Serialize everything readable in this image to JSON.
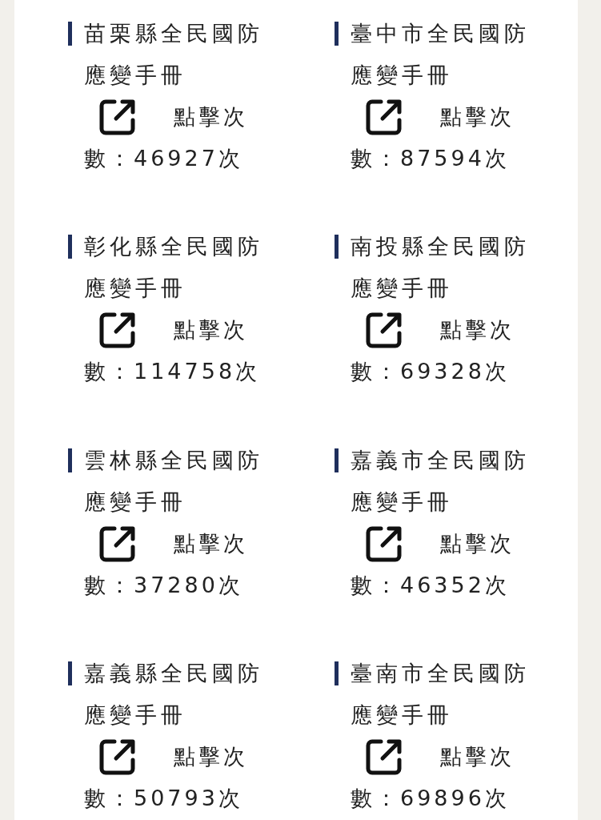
{
  "cards": [
    {
      "title": "苗栗縣全民國防應變手冊",
      "clicks_line_1": "點擊次",
      "clicks_line_2": "數：46927次"
    },
    {
      "title": "臺中市全民國防應變手冊",
      "clicks_line_1": "點擊次",
      "clicks_line_2": "數：87594次"
    },
    {
      "title": "彰化縣全民國防應變手冊",
      "clicks_line_1": "點擊次",
      "clicks_line_2": "數：114758次"
    },
    {
      "title": "南投縣全民國防應變手冊",
      "clicks_line_1": "點擊次",
      "clicks_line_2": "數：69328次"
    },
    {
      "title": "雲林縣全民國防應變手冊",
      "clicks_line_1": "點擊次",
      "clicks_line_2": "數：37280次"
    },
    {
      "title": "嘉義市全民國防應變手冊",
      "clicks_line_1": "點擊次",
      "clicks_line_2": "數：46352次"
    },
    {
      "title": "嘉義縣全民國防應變手冊",
      "clicks_line_1": "點擊次",
      "clicks_line_2": "數：50793次"
    },
    {
      "title": "臺南市全民國防應變手冊",
      "clicks_line_1": "點擊次",
      "clicks_line_2": "數：69896次"
    }
  ]
}
